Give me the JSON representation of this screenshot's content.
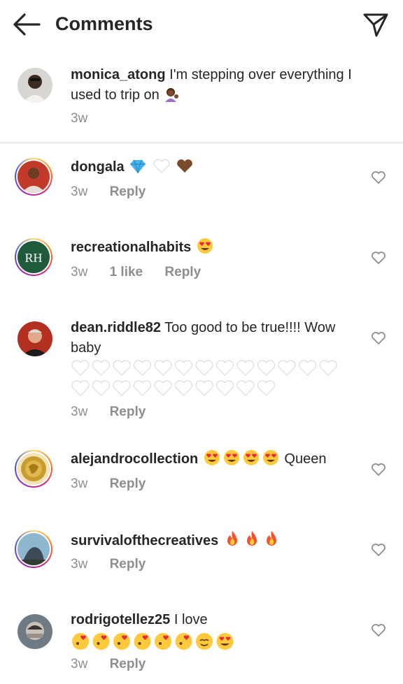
{
  "header": {
    "title": "Comments"
  },
  "caption": {
    "username": "monica_atong",
    "text": "I'm stepping over everything I used to trip on",
    "time": "3w"
  },
  "comments": [
    {
      "username": "dongala",
      "text": "",
      "time": "3w",
      "likes": "",
      "reply": "Reply"
    },
    {
      "username": "recreationalhabits",
      "text": "",
      "time": "3w",
      "likes": "1 like",
      "reply": "Reply",
      "avatar_text": "RH"
    },
    {
      "username": "dean.riddle82",
      "text": "Too good to be true!!!! Wow baby",
      "time": "3w",
      "likes": "",
      "reply": "Reply"
    },
    {
      "username": "alejandrocollection",
      "text": "Queen",
      "time": "3w",
      "likes": "",
      "reply": "Reply"
    },
    {
      "username": "survivalofthecreatives",
      "text": "",
      "time": "3w",
      "likes": "",
      "reply": "Reply"
    },
    {
      "username": "rodrigotellez25",
      "text": "I love",
      "time": "3w",
      "likes": "",
      "reply": "Reply"
    }
  ],
  "colors": {
    "text": "#262626",
    "meta": "#8e8e8e",
    "divider": "#dbdbdb"
  },
  "icons": [
    "back-arrow-icon",
    "send-icon",
    "heart-outline-icon"
  ]
}
